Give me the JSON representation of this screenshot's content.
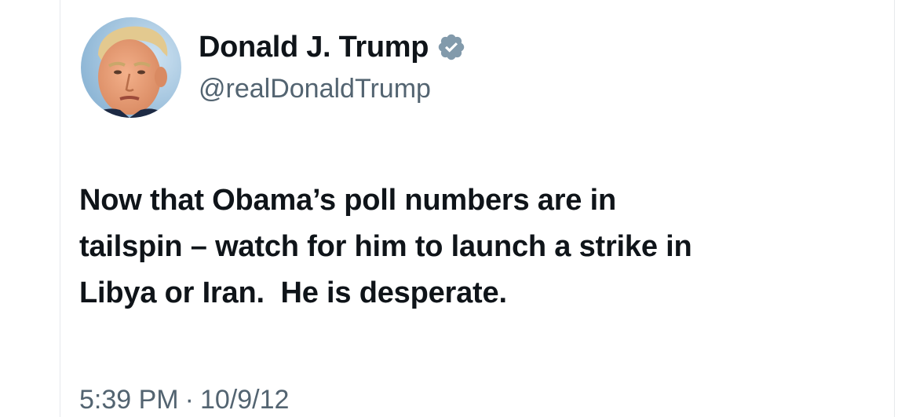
{
  "tweet": {
    "author": {
      "display_name": "Donald J. Trump",
      "handle": "@realDonaldTrump",
      "verified_icon": "verified-badge-icon",
      "avatar": "avatar"
    },
    "text_lines": [
      "Now that Obama’s poll numbers are in",
      "tailspin – watch for him to launch a strike in",
      "Libya or Iran.  He is desperate."
    ],
    "time": "5:39 PM",
    "separator": "·",
    "date": "10/9/12"
  },
  "colors": {
    "primary_text": "#0f1419",
    "secondary_text": "#536471",
    "verified_badge": "#829aab"
  }
}
